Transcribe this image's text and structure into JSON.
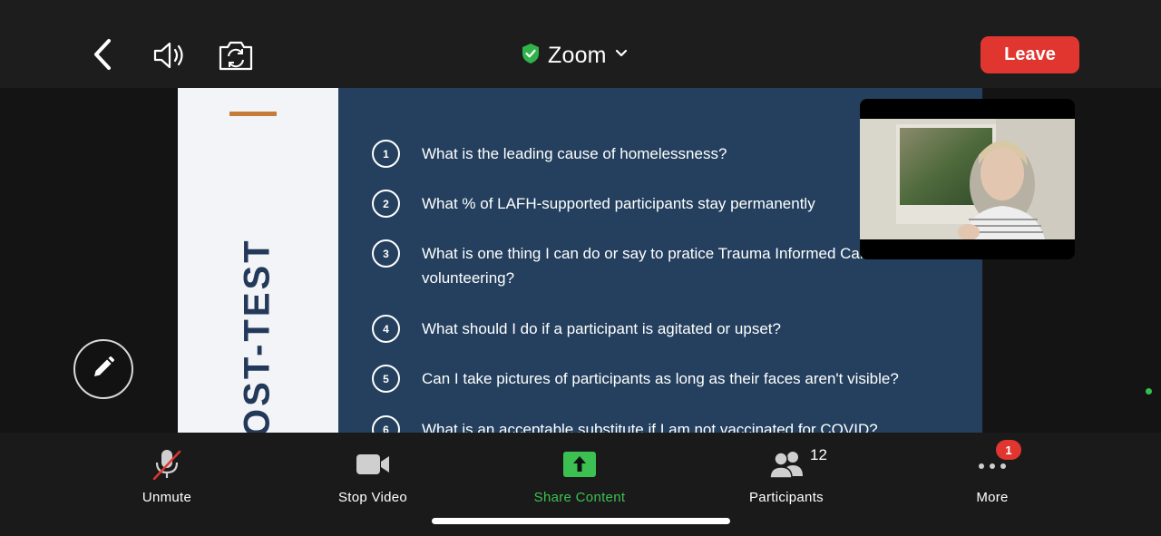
{
  "header": {
    "title": "Zoom",
    "leave_label": "Leave"
  },
  "slide": {
    "side_title": "POST-TEST",
    "questions": [
      {
        "num": "1",
        "text": "What is the leading cause of homelessness?"
      },
      {
        "num": "2",
        "text": "What % of LAFH-supported participants stay permanently"
      },
      {
        "num": "3",
        "text": "What is one thing I can do or say to pratice Trauma Informed Care while volunteering?"
      },
      {
        "num": "4",
        "text": "What should I do if a participant is agitated or upset?"
      },
      {
        "num": "5",
        "text": "Can I take pictures of participants as long as their faces aren't visible?"
      },
      {
        "num": "6",
        "text": "What is an acceptable substitute if I am not vaccinated for COVID?"
      }
    ]
  },
  "toolbar": {
    "unmute_label": "Unmute",
    "stop_video_label": "Stop Video",
    "share_label": "Share Content",
    "participants_label": "Participants",
    "participants_count": "12",
    "more_label": "More",
    "more_badge": "1"
  },
  "colors": {
    "leave": "#e0362f",
    "share": "#3cc052",
    "slide_bg": "#24405e",
    "accent": "#c57c3b"
  },
  "icons": [
    "back-icon",
    "speaker-icon",
    "camera-flip-icon",
    "shield-check-icon",
    "chevron-down-icon",
    "pencil-icon",
    "mic-muted-icon",
    "video-camera-icon",
    "share-arrow-icon",
    "participants-icon",
    "more-dots-icon"
  ]
}
